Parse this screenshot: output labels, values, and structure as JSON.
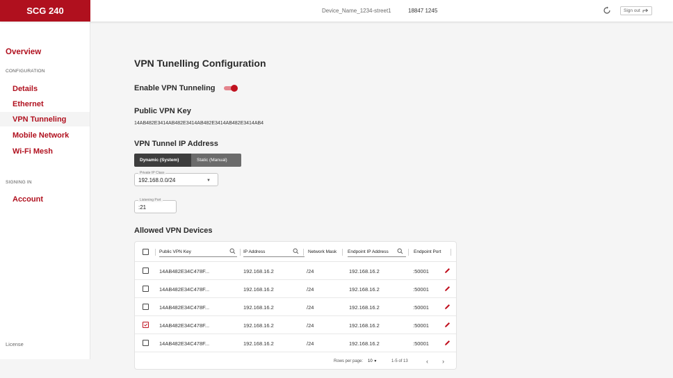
{
  "header": {
    "brand": "SCG 240",
    "device_name": "Device_Name_1234-street1",
    "serial": "18847 1245",
    "sign_out": "Sign out"
  },
  "sidebar": {
    "overview": "Overview",
    "configuration_section": "CONFIGURATION",
    "items": [
      {
        "label": "Details"
      },
      {
        "label": "Ethernet"
      },
      {
        "label": "VPN Tunneling"
      },
      {
        "label": "Mobile Network"
      },
      {
        "label": "Wi-Fi Mesh"
      }
    ],
    "signing_section": "SIGNING IN",
    "account": "Account",
    "license": "License"
  },
  "main": {
    "title": "VPN Tunelling Configuration",
    "enable_label": "Enable VPN Tunneling",
    "enable_on": true,
    "public_key_title": "Public VPN Key",
    "public_key_value": "14AB482E3414AB482E3414AB482E3414AB482E3414AB4",
    "tunnel_ip_title": "VPN Tunnel IP Address",
    "mode_options": [
      "Dynamic (System)",
      "Static (Manual)"
    ],
    "private_ip_label": "Private IP Class",
    "private_ip_value": "192.168.0.0/24",
    "listening_port_label": "Listening Port",
    "listening_port_value": ":21",
    "devices_title": "Allowed VPN Devices"
  },
  "table": {
    "columns": [
      "Public VPN Key",
      "IP Address",
      "Network Mask",
      "Endpoint IP Address",
      "Endpoint Port"
    ],
    "rows": [
      {
        "key": "14AB482E34C478F...",
        "ip": "192.168.16.2",
        "mask": "/24",
        "endpoint_ip": "192.168.16.2",
        "port": ":50001",
        "checked": false
      },
      {
        "key": "14AB482E34C478F...",
        "ip": "192.168.16.2",
        "mask": "/24",
        "endpoint_ip": "192.168.16.2",
        "port": ":50001",
        "checked": false
      },
      {
        "key": "14AB482E34C478F...",
        "ip": "192.168.16.2",
        "mask": "/24",
        "endpoint_ip": "192.168.16.2",
        "port": ":50001",
        "checked": false
      },
      {
        "key": "14AB482E34C478F...",
        "ip": "192.168.16.2",
        "mask": "/24",
        "endpoint_ip": "192.168.16.2",
        "port": ":50001",
        "checked": true
      },
      {
        "key": "14AB482E34C478F...",
        "ip": "192.168.16.2",
        "mask": "/24",
        "endpoint_ip": "192.168.16.2",
        "port": ":50001",
        "checked": false
      }
    ],
    "footer": {
      "rows_per_page_label": "Rows per page:",
      "rows_per_page_value": "10",
      "range": "1-5 of 13"
    }
  },
  "icons": {
    "refresh": "refresh-icon",
    "sign_out": "sign-out-icon",
    "search": "search-icon",
    "edit": "pencil-icon"
  },
  "colors": {
    "brand": "#b0101e",
    "accent": "#c0111f"
  }
}
